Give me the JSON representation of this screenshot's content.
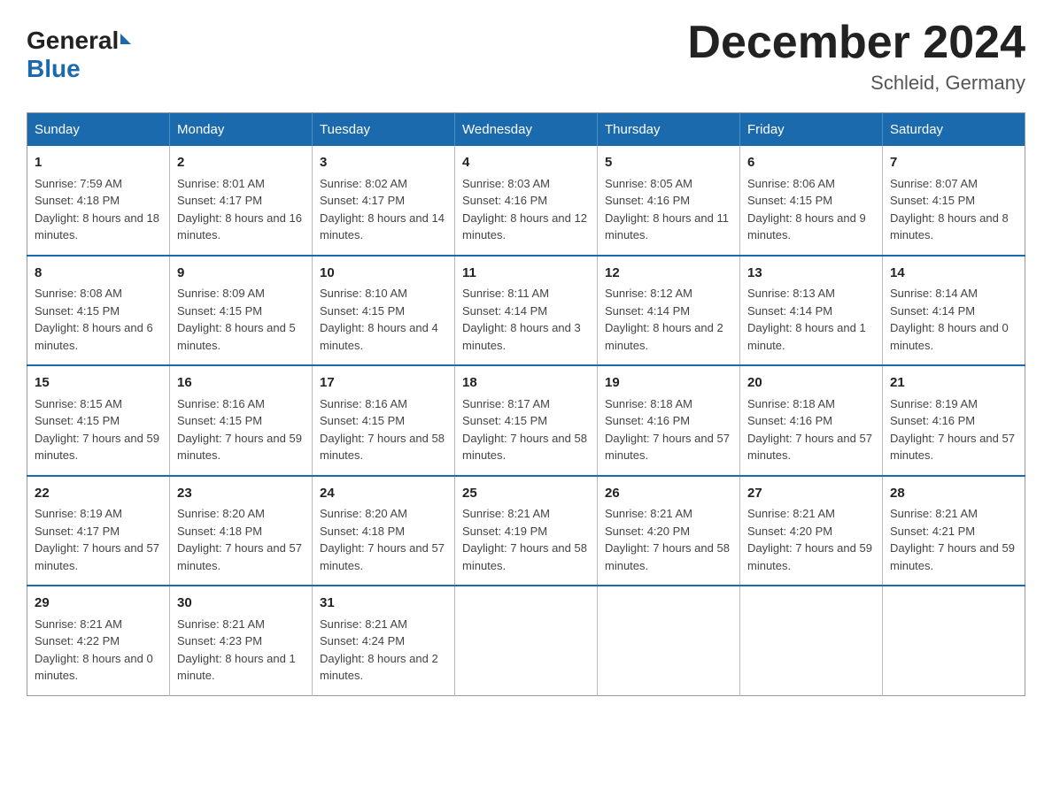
{
  "header": {
    "logo_general": "General",
    "logo_blue": "Blue",
    "month_title": "December 2024",
    "location": "Schleid, Germany"
  },
  "weekdays": [
    "Sunday",
    "Monday",
    "Tuesday",
    "Wednesday",
    "Thursday",
    "Friday",
    "Saturday"
  ],
  "weeks": [
    [
      {
        "day": "1",
        "sunrise": "7:59 AM",
        "sunset": "4:18 PM",
        "daylight": "8 hours and 18 minutes."
      },
      {
        "day": "2",
        "sunrise": "8:01 AM",
        "sunset": "4:17 PM",
        "daylight": "8 hours and 16 minutes."
      },
      {
        "day": "3",
        "sunrise": "8:02 AM",
        "sunset": "4:17 PM",
        "daylight": "8 hours and 14 minutes."
      },
      {
        "day": "4",
        "sunrise": "8:03 AM",
        "sunset": "4:16 PM",
        "daylight": "8 hours and 12 minutes."
      },
      {
        "day": "5",
        "sunrise": "8:05 AM",
        "sunset": "4:16 PM",
        "daylight": "8 hours and 11 minutes."
      },
      {
        "day": "6",
        "sunrise": "8:06 AM",
        "sunset": "4:15 PM",
        "daylight": "8 hours and 9 minutes."
      },
      {
        "day": "7",
        "sunrise": "8:07 AM",
        "sunset": "4:15 PM",
        "daylight": "8 hours and 8 minutes."
      }
    ],
    [
      {
        "day": "8",
        "sunrise": "8:08 AM",
        "sunset": "4:15 PM",
        "daylight": "8 hours and 6 minutes."
      },
      {
        "day": "9",
        "sunrise": "8:09 AM",
        "sunset": "4:15 PM",
        "daylight": "8 hours and 5 minutes."
      },
      {
        "day": "10",
        "sunrise": "8:10 AM",
        "sunset": "4:15 PM",
        "daylight": "8 hours and 4 minutes."
      },
      {
        "day": "11",
        "sunrise": "8:11 AM",
        "sunset": "4:14 PM",
        "daylight": "8 hours and 3 minutes."
      },
      {
        "day": "12",
        "sunrise": "8:12 AM",
        "sunset": "4:14 PM",
        "daylight": "8 hours and 2 minutes."
      },
      {
        "day": "13",
        "sunrise": "8:13 AM",
        "sunset": "4:14 PM",
        "daylight": "8 hours and 1 minute."
      },
      {
        "day": "14",
        "sunrise": "8:14 AM",
        "sunset": "4:14 PM",
        "daylight": "8 hours and 0 minutes."
      }
    ],
    [
      {
        "day": "15",
        "sunrise": "8:15 AM",
        "sunset": "4:15 PM",
        "daylight": "7 hours and 59 minutes."
      },
      {
        "day": "16",
        "sunrise": "8:16 AM",
        "sunset": "4:15 PM",
        "daylight": "7 hours and 59 minutes."
      },
      {
        "day": "17",
        "sunrise": "8:16 AM",
        "sunset": "4:15 PM",
        "daylight": "7 hours and 58 minutes."
      },
      {
        "day": "18",
        "sunrise": "8:17 AM",
        "sunset": "4:15 PM",
        "daylight": "7 hours and 58 minutes."
      },
      {
        "day": "19",
        "sunrise": "8:18 AM",
        "sunset": "4:16 PM",
        "daylight": "7 hours and 57 minutes."
      },
      {
        "day": "20",
        "sunrise": "8:18 AM",
        "sunset": "4:16 PM",
        "daylight": "7 hours and 57 minutes."
      },
      {
        "day": "21",
        "sunrise": "8:19 AM",
        "sunset": "4:16 PM",
        "daylight": "7 hours and 57 minutes."
      }
    ],
    [
      {
        "day": "22",
        "sunrise": "8:19 AM",
        "sunset": "4:17 PM",
        "daylight": "7 hours and 57 minutes."
      },
      {
        "day": "23",
        "sunrise": "8:20 AM",
        "sunset": "4:18 PM",
        "daylight": "7 hours and 57 minutes."
      },
      {
        "day": "24",
        "sunrise": "8:20 AM",
        "sunset": "4:18 PM",
        "daylight": "7 hours and 57 minutes."
      },
      {
        "day": "25",
        "sunrise": "8:21 AM",
        "sunset": "4:19 PM",
        "daylight": "7 hours and 58 minutes."
      },
      {
        "day": "26",
        "sunrise": "8:21 AM",
        "sunset": "4:20 PM",
        "daylight": "7 hours and 58 minutes."
      },
      {
        "day": "27",
        "sunrise": "8:21 AM",
        "sunset": "4:20 PM",
        "daylight": "7 hours and 59 minutes."
      },
      {
        "day": "28",
        "sunrise": "8:21 AM",
        "sunset": "4:21 PM",
        "daylight": "7 hours and 59 minutes."
      }
    ],
    [
      {
        "day": "29",
        "sunrise": "8:21 AM",
        "sunset": "4:22 PM",
        "daylight": "8 hours and 0 minutes."
      },
      {
        "day": "30",
        "sunrise": "8:21 AM",
        "sunset": "4:23 PM",
        "daylight": "8 hours and 1 minute."
      },
      {
        "day": "31",
        "sunrise": "8:21 AM",
        "sunset": "4:24 PM",
        "daylight": "8 hours and 2 minutes."
      },
      null,
      null,
      null,
      null
    ]
  ],
  "labels": {
    "sunrise": "Sunrise:",
    "sunset": "Sunset:",
    "daylight": "Daylight:"
  }
}
